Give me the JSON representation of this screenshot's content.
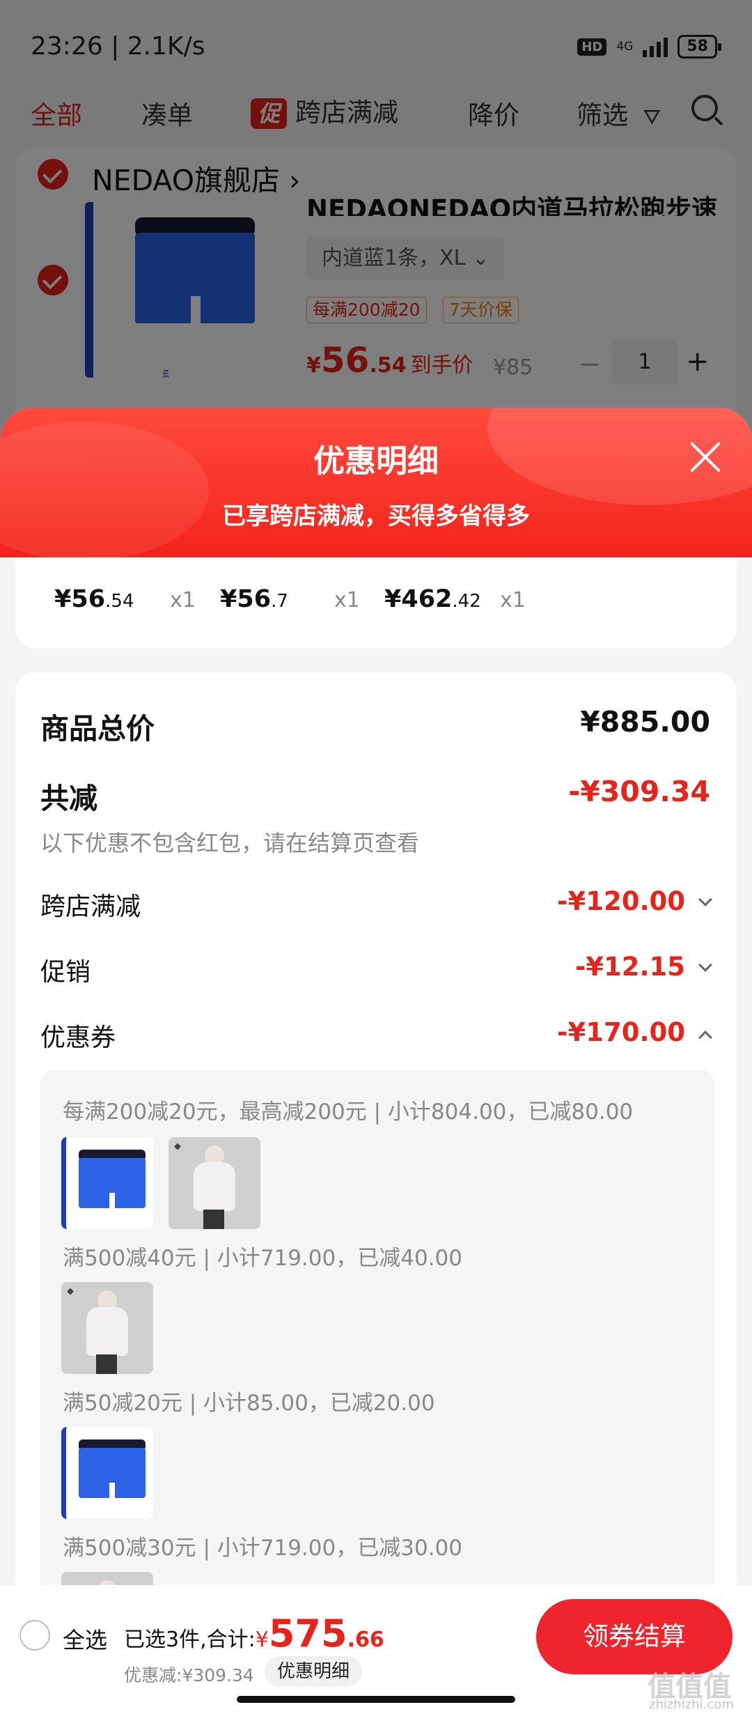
{
  "status_bar": {
    "time": "23:26 | 2.1K/s",
    "hd": "HD",
    "network": "4G",
    "battery": "58"
  },
  "filter_tabs": [
    {
      "label": "全部",
      "active": true
    },
    {
      "label": "凑单",
      "active": false
    },
    {
      "label": "跨店满减",
      "badge": "促",
      "active": false
    },
    {
      "label": "降价",
      "active": false
    },
    {
      "label": "筛选",
      "active": false
    }
  ],
  "store": {
    "name": "NEDAO旗舰店",
    "product": {
      "title": "NEDAONEDAO内道马拉松跑步速",
      "sku": "内道蓝1条，XL",
      "tags": [
        "每满200减20",
        "7天价保"
      ],
      "price_int": "56",
      "price_dec": ".54",
      "price_label": "到手价",
      "orig_price": "¥85",
      "quantity": "1",
      "brand_mark": "NEDAO"
    }
  },
  "sheet": {
    "title": "优惠明细",
    "subtitle": "已享跨店满减，买得多省得多",
    "items": [
      {
        "price_int": "¥56",
        "price_dec": ".54",
        "qty": "x1"
      },
      {
        "price_int": "¥56",
        "price_dec": ".7",
        "qty": "x1"
      },
      {
        "price_int": "¥462",
        "price_dec": ".42",
        "qty": "x1"
      }
    ],
    "total_label": "商品总价",
    "total_value": "¥885.00",
    "reduce_label": "共减",
    "reduce_value": "-¥309.34",
    "reduce_note": "以下优惠不包含红包，请在结算页查看",
    "rows": [
      {
        "label": "跨店满减",
        "value": "-¥120.00",
        "expanded": false
      },
      {
        "label": "促销",
        "value": "-¥12.15",
        "expanded": false
      },
      {
        "label": "优惠券",
        "value": "-¥170.00",
        "expanded": true
      }
    ],
    "coupon_groups": [
      "每满200减20元，最高减200元 | 小计804.00，已减80.00",
      "满500减40元 | 小计719.00，已减40.00",
      "满50减20元 | 小计85.00，已减20.00",
      "满500减30元 | 小计719.00，已减30.00"
    ]
  },
  "bottom_bar": {
    "select_all": "全选",
    "summary_prefix": "已选3件,合计:",
    "yen": "¥",
    "total_int": "575",
    "total_dec": ".66",
    "discount": "优惠减:¥309.34",
    "detail_button": "优惠明细",
    "checkout_button": "领券结算"
  },
  "watermark": {
    "main": "值值值",
    "sub": "zhizhizhi.com"
  },
  "colors": {
    "accent_red": "#e8231a",
    "checkout_red": "#f0242c",
    "brand_blue": "#2b62e6"
  }
}
